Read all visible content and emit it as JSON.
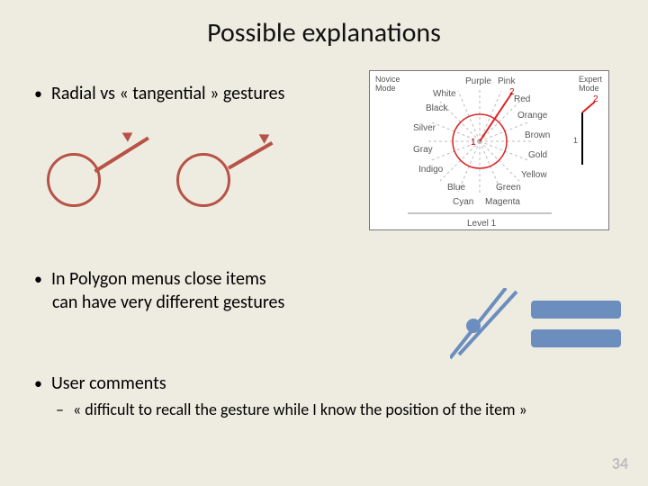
{
  "title": "Possible explanations",
  "bullets": {
    "b1": "Radial vs « tangential » gestures",
    "b2_line1": "In Polygon menus close items",
    "b2_line2": "can have very different gestures",
    "b3": "User comments",
    "sub1": "« difficult to recall the gesture while I know the position of the item »"
  },
  "menu": {
    "novice": "Novice\nMode",
    "expert": "Expert\nMode",
    "labels": [
      "Purple",
      "Pink",
      "White",
      "Red",
      "Black",
      "Orange",
      "Silver",
      "Brown",
      "Gray",
      "Gold",
      "Indigo",
      "Yellow",
      "Blue",
      "Green",
      "Cyan",
      "Magenta"
    ],
    "level": "Level 1",
    "marks": {
      "one": "1",
      "two": "2"
    }
  },
  "pagenum": "34"
}
